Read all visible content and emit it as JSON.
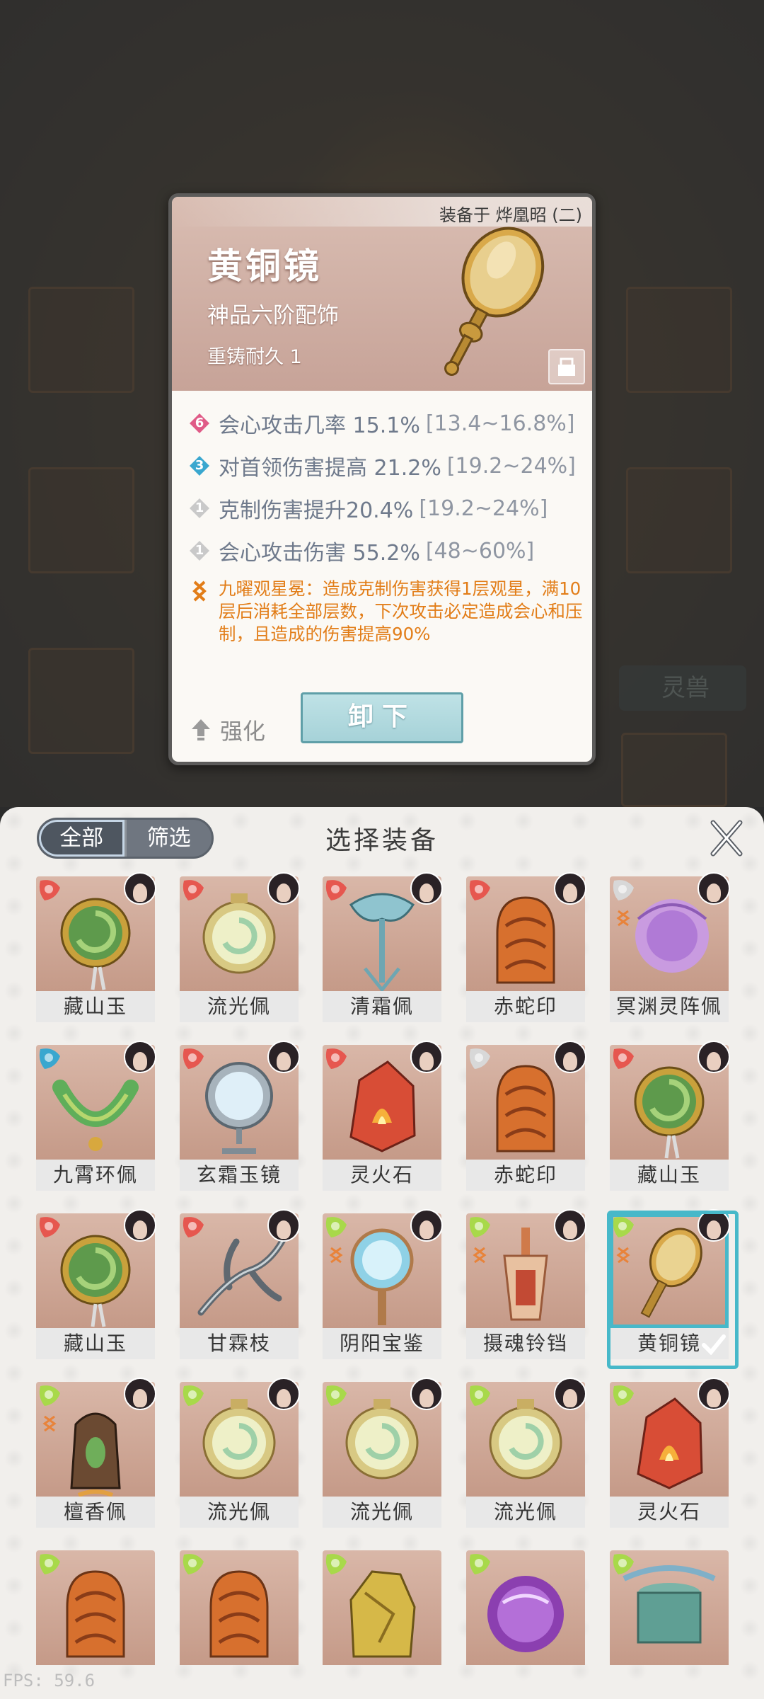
{
  "background": {
    "ghost_tab_label": "灵兽"
  },
  "detail": {
    "equipped_on": "装备于 烨凰昭 (二)",
    "name": "黄铜镜",
    "grade": "神品六阶配饰",
    "durability": "重铸耐久 1",
    "stats": [
      {
        "badge": "6",
        "badge_color": "#e05b87",
        "text": "会心攻击几率 15.1%",
        "range": "[13.4~16.8%]"
      },
      {
        "badge": "3",
        "badge_color": "#3aa7cf",
        "text": "对首领伤害提高 21.2%",
        "range": "[19.2~24%]"
      },
      {
        "badge": "1",
        "badge_color": "#c9c9c9",
        "text": "克制伤害提升20.4%",
        "range": "[19.2~24%]"
      },
      {
        "badge": "1",
        "badge_color": "#c9c9c9",
        "text": "会心攻击伤害 55.2%",
        "range": "[48~60%]"
      }
    ],
    "special": "九曜观星冕：造成克制伤害获得1层观星，满10层后消耗全部层数，下次攻击必定造成会心和压制，且造成的伤害提高90%",
    "special_color": "#e27d18",
    "enhance_label": "强化",
    "unequip_label": "卸下"
  },
  "panel": {
    "title": "选择装备",
    "filters": [
      "全部",
      "筛选"
    ],
    "active_filter": "全部",
    "items": [
      {
        "name": "藏山玉",
        "elem": "#e6574f",
        "art": "jade-disc"
      },
      {
        "name": "流光佩",
        "elem": "#e6574f",
        "art": "pale-disc"
      },
      {
        "name": "清霜佩",
        "elem": "#e6574f",
        "art": "blue-pendant"
      },
      {
        "name": "赤蛇印",
        "elem": "#e6574f",
        "art": "snake-seal"
      },
      {
        "name": "冥渊灵阵佩",
        "elem": "#d8d8d8",
        "art": "purple-orb",
        "tag": true
      },
      {
        "name": "九霄环佩",
        "elem": "#3aa7cf",
        "art": "green-ring"
      },
      {
        "name": "玄霜玉镜",
        "elem": "#e6574f",
        "art": "frost-mirror"
      },
      {
        "name": "灵火石",
        "elem": "#e6574f",
        "art": "fire-stone"
      },
      {
        "name": "赤蛇印",
        "elem": "#d8d8d8",
        "art": "snake-seal"
      },
      {
        "name": "藏山玉",
        "elem": "#e6574f",
        "art": "jade-disc"
      },
      {
        "name": "藏山玉",
        "elem": "#e6574f",
        "art": "jade-disc"
      },
      {
        "name": "甘霖枝",
        "elem": "#e6574f",
        "art": "branch"
      },
      {
        "name": "阴阳宝鉴",
        "elem": "#a8d94a",
        "art": "yinyang-mirror",
        "tag": true
      },
      {
        "name": "摄魂铃铛",
        "elem": "#a8d94a",
        "art": "bell",
        "tag": true
      },
      {
        "name": "黄铜镜",
        "elem": "#a8d94a",
        "art": "brass-mirror",
        "tag": true,
        "selected": true
      },
      {
        "name": "檀香佩",
        "elem": "#a8d94a",
        "art": "incense",
        "tag": true
      },
      {
        "name": "流光佩",
        "elem": "#a8d94a",
        "art": "pale-disc"
      },
      {
        "name": "流光佩",
        "elem": "#a8d94a",
        "art": "pale-disc"
      },
      {
        "name": "流光佩",
        "elem": "#a8d94a",
        "art": "pale-disc"
      },
      {
        "name": "灵火石",
        "elem": "#a8d94a",
        "art": "fire-stone"
      },
      {
        "name": "",
        "elem": "#a8d94a",
        "art": "snake-seal"
      },
      {
        "name": "",
        "elem": "#a8d94a",
        "art": "snake-seal"
      },
      {
        "name": "",
        "elem": "#a8d94a",
        "art": "gold-rock"
      },
      {
        "name": "",
        "elem": "#a8d94a",
        "art": "purple-orb2"
      },
      {
        "name": "",
        "elem": "#a8d94a",
        "art": "drum"
      }
    ]
  },
  "fps": "FPS: 59.6"
}
